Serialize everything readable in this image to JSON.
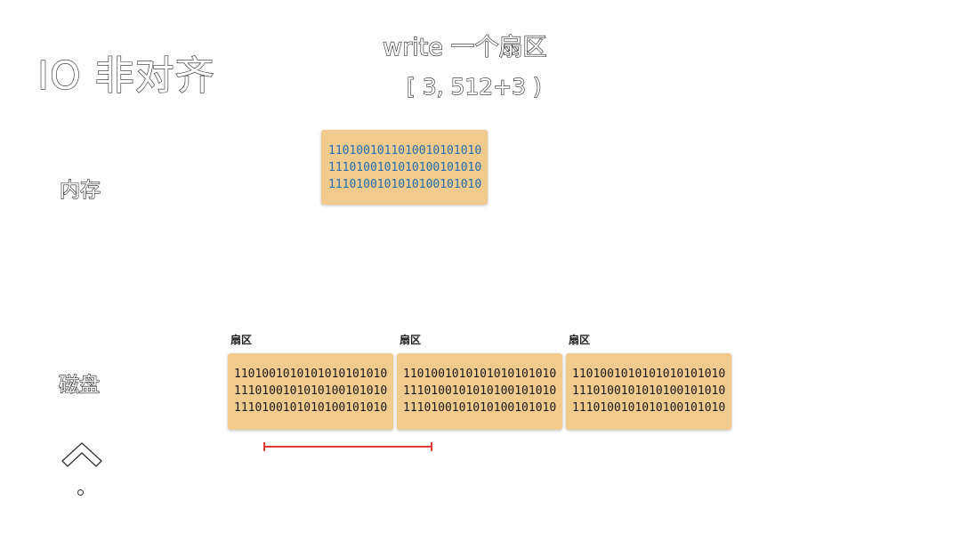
{
  "title": "IO 非对齐",
  "operation": {
    "line1": "write 一个扇区",
    "line2": "[ 3, 512+3 )"
  },
  "labels": {
    "memory": "内存",
    "disk": "磁盘"
  },
  "memory_block": {
    "lines": [
      "1101001011010010101010",
      "1110100101010100101010",
      "1110100101010100101010"
    ]
  },
  "sectors": [
    {
      "label": "扇区",
      "lines": [
        "1101001010101010101010",
        "1110100101010100101010",
        "1110100101010100101010"
      ]
    },
    {
      "label": "扇区",
      "lines": [
        "1101001010101010101010",
        "1110100101010100101010",
        "1110100101010100101010"
      ]
    },
    {
      "label": "扇区",
      "lines": [
        "1101001010101010101010",
        "1110100101010100101010",
        "1110100101010100101010"
      ]
    }
  ],
  "colors": {
    "block_fill": "#f1ca8d",
    "memory_text": "#1f6db0",
    "range_marker": "#e53935"
  },
  "icons": [
    "up-chevron-icon"
  ]
}
